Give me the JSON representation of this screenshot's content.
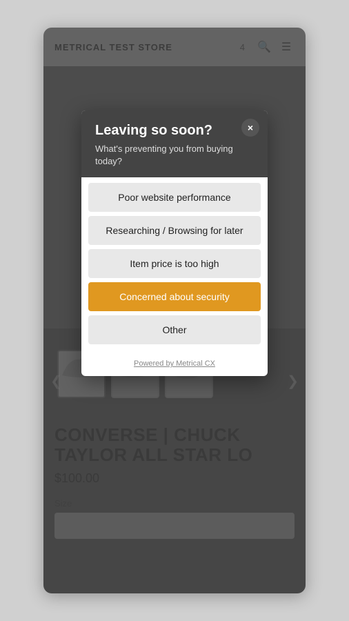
{
  "store": {
    "title": "METRICAL TEST STORE",
    "number": "4"
  },
  "product": {
    "name": "CONVERSE | CHUCK TAYLOR ALL STAR LO",
    "price": "$100.00",
    "size_label": "Size"
  },
  "modal": {
    "title": "Leaving so soon?",
    "subtitle": "What's preventing you from buying today?",
    "close_label": "×",
    "options": [
      {
        "id": "poor-perf",
        "label": "Poor website performance",
        "active": false
      },
      {
        "id": "researching",
        "label": "Researching / Browsing for later",
        "active": false
      },
      {
        "id": "price-high",
        "label": "Item price is too high",
        "active": false
      },
      {
        "id": "security",
        "label": "Concerned about security",
        "active": true
      },
      {
        "id": "other",
        "label": "Other",
        "active": false
      }
    ],
    "powered_by": "Powered by Metrical CX"
  },
  "nav": {
    "left_arrow": "❮",
    "right_arrow": "❯"
  }
}
